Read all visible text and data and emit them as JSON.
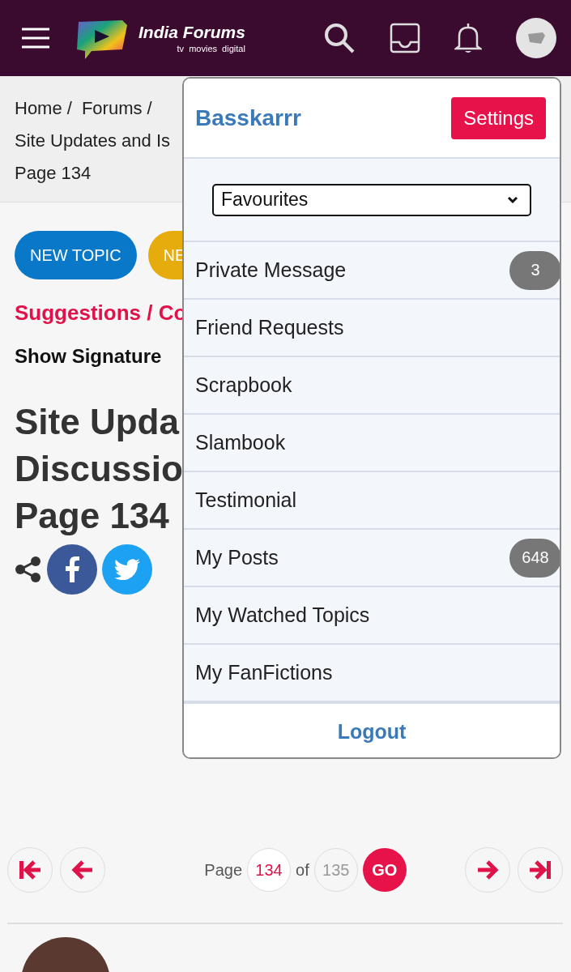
{
  "header": {
    "logo_title": "India Forums",
    "logo_tagline": "tv  movies  digital"
  },
  "breadcrumb": [
    "Home /",
    "Forums /",
    "Site Updates and Is",
    "Page 134"
  ],
  "buttons": [
    {
      "label": "NEW TOPIC",
      "kind": "primary"
    },
    {
      "label": "NE",
      "kind": "secondary"
    }
  ],
  "forum_link": "Suggestions / Co",
  "show_signature": "Show Signature",
  "title_lines": [
    "Site Upda",
    "Discussio",
    "Page 134"
  ],
  "pagination": {
    "label": "Page",
    "page": "134",
    "of": "of",
    "total": "135",
    "go": "GO"
  },
  "user_menu": {
    "username": "Basskarrr",
    "settings": "Settings",
    "select": "Favourites",
    "items": [
      {
        "label": "Private Message",
        "badge": "3"
      },
      {
        "label": "Friend Requests"
      },
      {
        "label": "Scrapbook"
      },
      {
        "label": "Slambook"
      },
      {
        "label": "Testimonial"
      },
      {
        "label": "My Posts",
        "badge": "648"
      },
      {
        "label": "My Watched Topics"
      },
      {
        "label": "My FanFictions"
      }
    ],
    "logout": "Logout"
  }
}
